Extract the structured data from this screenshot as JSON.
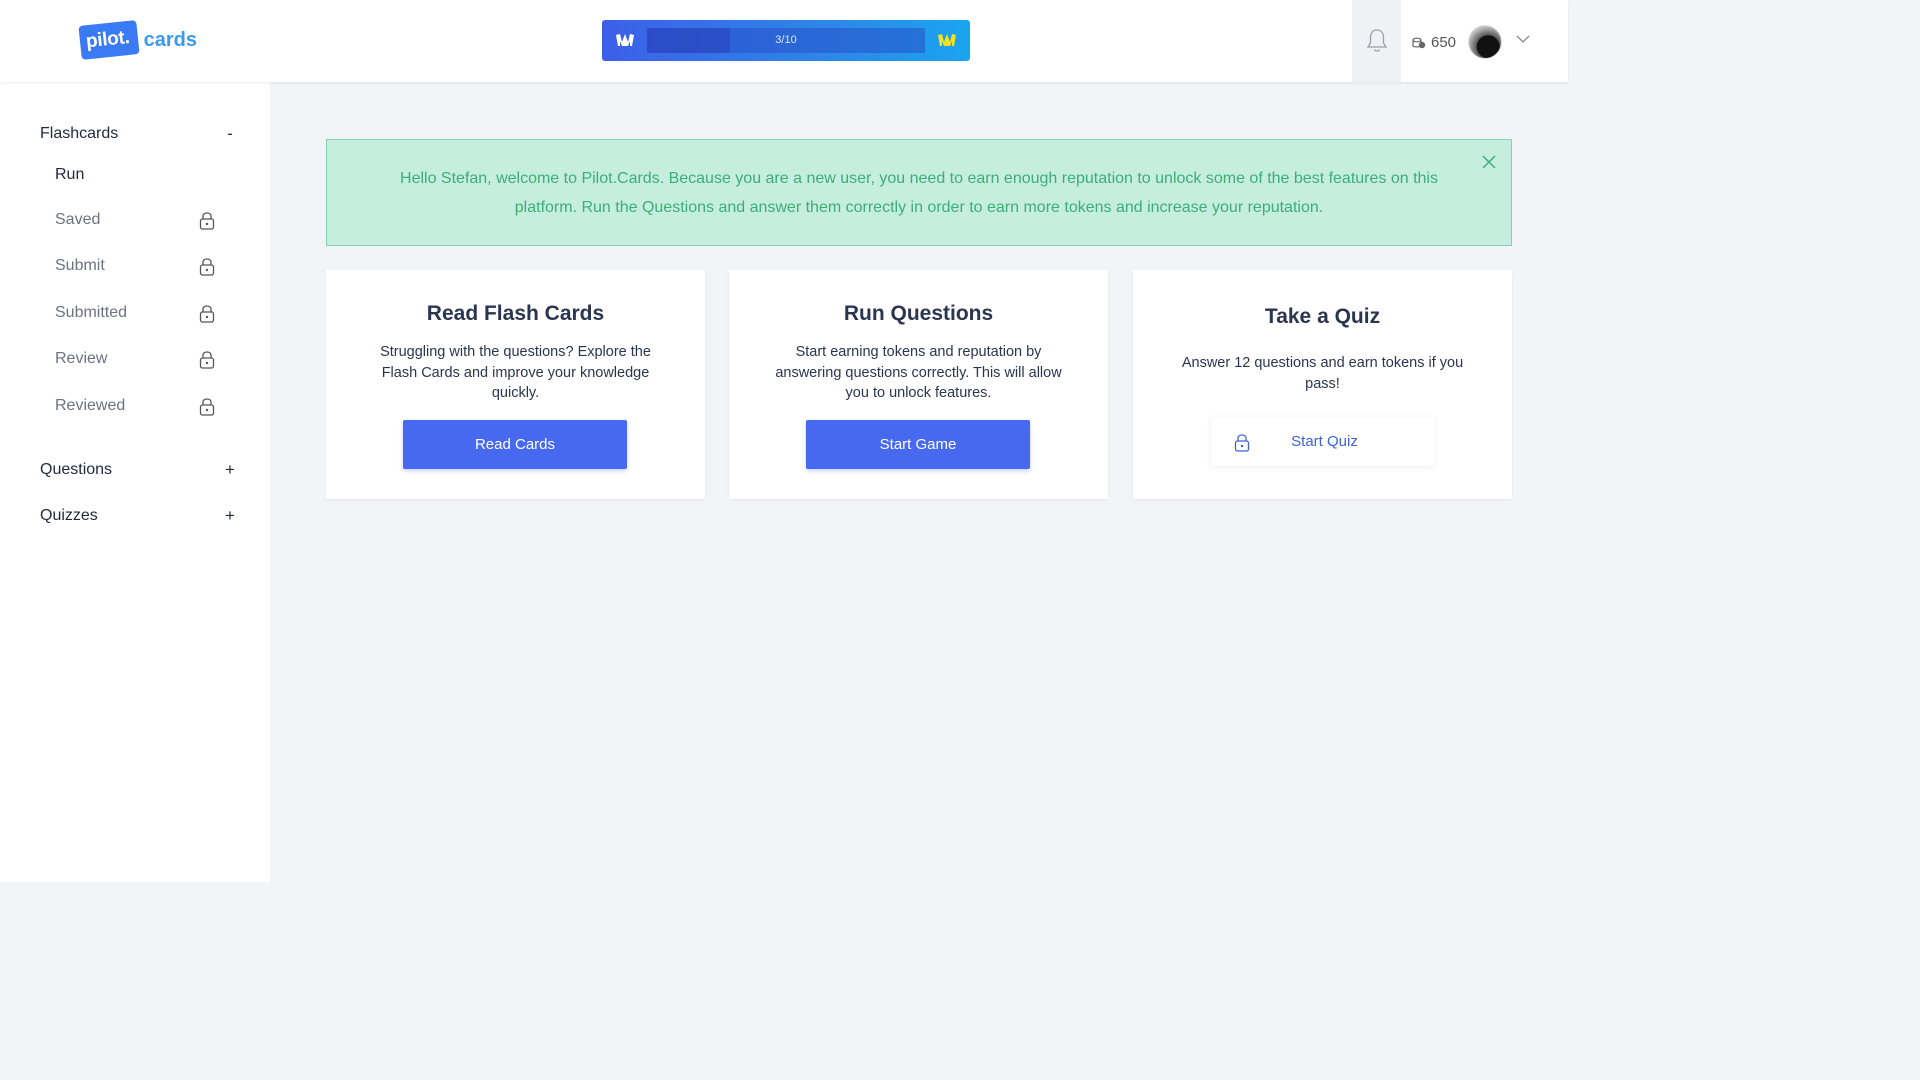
{
  "header": {
    "logo_badge": "pilot.",
    "logo_text": "cards",
    "progress": {
      "label": "3/10",
      "fraction": 0.3
    },
    "tokens": "650",
    "icons": [
      "crown-icon",
      "bell-icon",
      "coins-icon",
      "chevron-down-icon"
    ]
  },
  "sidebar": {
    "flashcards": {
      "label": "Flashcards",
      "toggle": "-",
      "items": [
        {
          "label": "Run",
          "locked": false
        },
        {
          "label": "Saved",
          "locked": true
        },
        {
          "label": "Submit",
          "locked": true
        },
        {
          "label": "Submitted",
          "locked": true
        },
        {
          "label": "Review",
          "locked": true
        },
        {
          "label": "Reviewed",
          "locked": true
        }
      ]
    },
    "questions": {
      "label": "Questions",
      "toggle": "+"
    },
    "quizzes": {
      "label": "Quizzes",
      "toggle": "+"
    }
  },
  "alert": {
    "text": "Hello Stefan, welcome to Pilot.Cards. Because you are a new user, you need to earn enough reputation to unlock some of the best features on this platform. Run the Questions and answer them correctly in order to earn more tokens and increase your reputation."
  },
  "cards": [
    {
      "title": "Read Flash Cards",
      "text": "Struggling with the questions? Explore the Flash Cards and improve your knowledge quickly.",
      "button": "Read Cards"
    },
    {
      "title": "Run Questions",
      "text": "Start earning tokens and reputation by answering questions correctly. This will allow you to unlock features.",
      "button": "Start Game"
    },
    {
      "title": "Take a Quiz",
      "text": "Answer 12 questions and earn tokens if you pass!",
      "button": "Start Quiz",
      "locked": true
    }
  ],
  "colors": {
    "primary": "#4769f0",
    "alert_bg": "#c6eedf",
    "alert_text": "#3cae7a",
    "page_bg": "#f3f4f8"
  }
}
